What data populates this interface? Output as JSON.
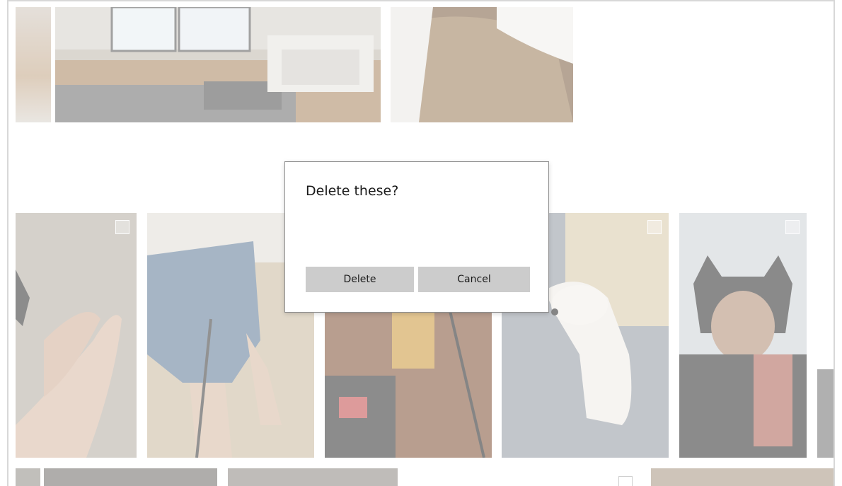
{
  "dialog": {
    "title": "Delete these?",
    "confirm_label": "Delete",
    "cancel_label": "Cancel"
  },
  "photos": [
    {
      "name": "photo-partial-left-top",
      "color": "#c9b49a"
    },
    {
      "name": "photo-desk-monitors",
      "color": "#9a9080"
    },
    {
      "name": "photo-sofa-cushion",
      "color": "#8f6f4f"
    },
    {
      "name": "photo-bare-feet",
      "color": "#b8ada0"
    },
    {
      "name": "photo-shorts-legs",
      "color": "#7f93a8"
    },
    {
      "name": "photo-table-glass",
      "color": "#8a5a3c"
    },
    {
      "name": "photo-dog",
      "color": "#9aa0a6"
    },
    {
      "name": "photo-cat-mask",
      "color": "#5a5a5a"
    },
    {
      "name": "photo-partial-right",
      "color": "#6a6a6a"
    }
  ]
}
